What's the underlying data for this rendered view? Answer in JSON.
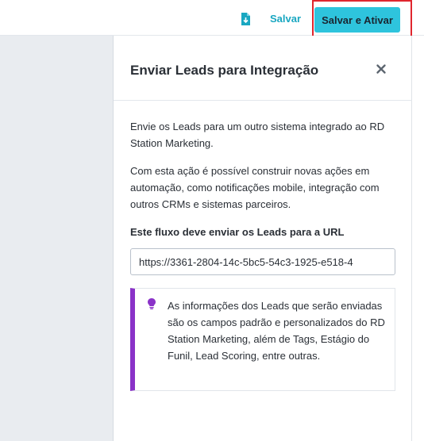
{
  "toolbar": {
    "export_icon": "file-download-icon",
    "save_label": "Salvar",
    "save_activate_label": "Salvar e Ativar"
  },
  "panel": {
    "title": "Enviar Leads para Integração",
    "close_icon": "close-icon",
    "description_1": "Envie os Leads para um outro sistema integrado ao RD Station Marketing.",
    "description_2": "Com esta ação é possível construir novas ações em automação, como notificações mobile, integração com outros CRMs e sistemas parceiros.",
    "url_label": "Este fluxo deve enviar os Leads para a URL",
    "url_value": "https://3361-2804-14c-5bc5-54c3-1925-e518-4",
    "info_icon": "lightbulb-icon",
    "info_text": "As informações dos Leads que serão enviadas são os campos padrão e personalizados do RD Station Marketing, além de Tags, Estágio do Funil, Lead Scoring, entre outras."
  },
  "colors": {
    "accent_button": "#2ec4dd",
    "link": "#19a7c1",
    "highlight": "#e0262e",
    "info_border": "#8a32c8"
  }
}
